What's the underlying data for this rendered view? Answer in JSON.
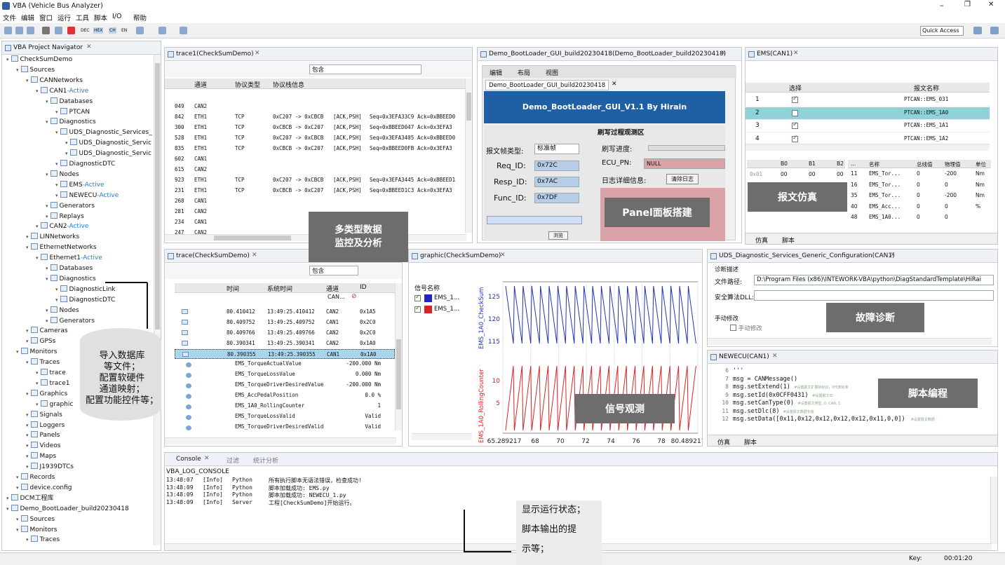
{
  "window": {
    "title": "VBA (Vehicle Bus Analyzer)",
    "minimize": "–",
    "restore": "❐",
    "close": "✕"
  },
  "menu": [
    "文件",
    "编辑",
    "窗口",
    "运行",
    "工具",
    "脚本",
    "I/O",
    "帮助"
  ],
  "toolbar": {
    "dec": "DEC",
    "hex": "HEX",
    "ch": "CH",
    "en": "EN",
    "quick_access": "Quick Access"
  },
  "navigator": {
    "title": "VBA Project Navigator",
    "tree": [
      {
        "l": 0,
        "t": "CheckSumDemo"
      },
      {
        "l": 1,
        "t": "Sources"
      },
      {
        "l": 2,
        "t": "CANNetworks"
      },
      {
        "l": 3,
        "t": "CAN1",
        "a": "-Active"
      },
      {
        "l": 4,
        "t": "Databases"
      },
      {
        "l": 5,
        "t": "PTCAN"
      },
      {
        "l": 4,
        "t": "Diagnostics"
      },
      {
        "l": 5,
        "t": "UDS_Diagnostic_Services_"
      },
      {
        "l": 6,
        "t": "UDS_Diagnostic_Servic"
      },
      {
        "l": 6,
        "t": "UDS_Diagnostic_Servic"
      },
      {
        "l": 5,
        "t": "DiagnosticDTC"
      },
      {
        "l": 4,
        "t": "Nodes"
      },
      {
        "l": 5,
        "t": "EMS",
        "a": "-Active"
      },
      {
        "l": 5,
        "t": "NEWECU",
        "a": "-Active"
      },
      {
        "l": 4,
        "t": "Generators"
      },
      {
        "l": 4,
        "t": "Replays"
      },
      {
        "l": 3,
        "t": "CAN2",
        "a": "-Active"
      },
      {
        "l": 2,
        "t": "LINNetworks"
      },
      {
        "l": 2,
        "t": "EthernetNetworks"
      },
      {
        "l": 3,
        "t": "Ethernet1",
        "a": "-Active"
      },
      {
        "l": 4,
        "t": "Databases"
      },
      {
        "l": 4,
        "t": "Diagnostics"
      },
      {
        "l": 5,
        "t": "DiagnosticLink"
      },
      {
        "l": 5,
        "t": "DiagnosticDTC"
      },
      {
        "l": 4,
        "t": "Nodes"
      },
      {
        "l": 4,
        "t": "Generators"
      },
      {
        "l": 2,
        "t": "Cameras"
      },
      {
        "l": 2,
        "t": "GPSs"
      },
      {
        "l": 1,
        "t": "Monitors"
      },
      {
        "l": 2,
        "t": "Traces"
      },
      {
        "l": 3,
        "t": "trace"
      },
      {
        "l": 3,
        "t": "trace1"
      },
      {
        "l": 2,
        "t": "Graphics"
      },
      {
        "l": 3,
        "t": "graphic"
      },
      {
        "l": 2,
        "t": "Signals"
      },
      {
        "l": 2,
        "t": "Loggers"
      },
      {
        "l": 2,
        "t": "Panels"
      },
      {
        "l": 2,
        "t": "Videos"
      },
      {
        "l": 2,
        "t": "Maps"
      },
      {
        "l": 2,
        "t": "J1939DTCs"
      },
      {
        "l": 1,
        "t": "Records"
      },
      {
        "l": 1,
        "t": "device.config"
      },
      {
        "l": 0,
        "t": "DCM工程库"
      },
      {
        "l": 0,
        "t": "Demo_BootLoader_build20230418"
      },
      {
        "l": 1,
        "t": "Sources"
      },
      {
        "l": 1,
        "t": "Monitors"
      },
      {
        "l": 2,
        "t": "Traces"
      }
    ]
  },
  "trace1": {
    "title": "trace1(CheckSumDemo)",
    "filter": "包含",
    "cols": [
      "通道",
      "协议类型",
      "协议栈信息"
    ],
    "rows": [
      [
        "049",
        "CAN2",
        "",
        "",
        "",
        ""
      ],
      [
        "842",
        "ETH1",
        "TCP",
        "0xC207 -> 0xCBCB",
        "[ACK,PSH]",
        "Seq=0x3EFA33C9",
        "Ack=0xBBEED0"
      ],
      [
        "300",
        "ETH1",
        "TCP",
        "0xCBCB -> 0xC207",
        "[ACK,PSH]",
        "Seq=0xBBEED047",
        "Ack=0x3EFA3"
      ],
      [
        "528",
        "ETH1",
        "TCP",
        "0xC207 -> 0xCBCB",
        "[ACK,PSH]",
        "Seq=0x3EFA3405",
        "Ack=0xBBEED0"
      ],
      [
        "835",
        "ETH1",
        "TCP",
        "0xCBCB -> 0xC207",
        "[ACK,PSH]",
        "Seq=0xBBEED0FB",
        "Ack=0x3EFA3"
      ],
      [
        "602",
        "CAN1",
        "",
        "",
        "",
        ""
      ],
      [
        "615",
        "CAN2",
        "",
        "",
        "",
        ""
      ],
      [
        "923",
        "ETH1",
        "TCP",
        "0xC207 -> 0xCBCB",
        "[ACK,PSH]",
        "Seq=0x3EFA3445",
        "Ack=0xBBEED1"
      ],
      [
        "231",
        "ETH1",
        "TCP",
        "0xCBCB -> 0xC207",
        "[ACK,PSH]",
        "Seq=0xBBEED1C3",
        "Ack=0x3EFA3"
      ],
      [
        "268",
        "CAN1",
        "",
        "",
        "",
        ""
      ],
      [
        "281",
        "CAN2",
        "",
        "",
        "",
        ""
      ],
      [
        "234",
        "CAN1",
        "",
        "",
        "",
        ""
      ],
      [
        "247",
        "CAN2",
        "",
        "",
        "",
        ""
      ]
    ]
  },
  "trace": {
    "title": "trace(CheckSumDemo)",
    "filter": "包含",
    "cols": [
      "时间",
      "系统时间",
      "通道",
      "ID"
    ],
    "chan_filter": "CAN...",
    "rows": [
      [
        "80.410412",
        "13:49:25.410412",
        "CAN2",
        "0x1A5"
      ],
      [
        "80.409752",
        "13:49:25.409752",
        "CAN1",
        "0x2C0"
      ],
      [
        "80.409766",
        "13:49:25.409766",
        "CAN2",
        "0x2C0"
      ],
      [
        "80.390341",
        "13:49:25.390341",
        "CAN2",
        "0x1A0"
      ],
      [
        "80.390355",
        "13:49:25.390355",
        "CAN1",
        "0x1A0"
      ]
    ],
    "signals": [
      [
        "EMS_TorqueActualValue",
        "-200.000 Nm"
      ],
      [
        "EMS_TorqueLossValue",
        "0.000 Nm"
      ],
      [
        "EMS_TorqueDriverDesiredValue",
        "-200.000 Nm"
      ],
      [
        "EMS_AccPedalPosition",
        "0.0 %"
      ],
      [
        "EMS_1A0_RollingCounter",
        "1"
      ],
      [
        "EMS_TorqueLossValid",
        "Valid"
      ],
      [
        "EMS_TorqueDriverDesiredValid",
        "Valid"
      ]
    ]
  },
  "panel": {
    "title": "Demo_BootLoader_GUI_build20230418(Demo_BootLoader_build20230418)",
    "menus": [
      "编辑",
      "布局",
      "视图"
    ],
    "tab": "Demo_BootLoader_GUI_build20230418",
    "banner": "Demo_BootLoader_GUI_V1.1    By Hirain",
    "section": "刷写过程观测区",
    "frame_type_label": "报文帧类型:",
    "frame_type": "标准帧",
    "req_label": "Req_ID:",
    "req": "0x72C",
    "resp_label": "Resp_ID:",
    "resp": "0x7AC",
    "func_label": "Func_ID:",
    "func": "0x7DF",
    "progress_label": "刷写进度:",
    "ecu_label": "ECU_PN:",
    "ecu": "NULL",
    "log_label": "日志详细信息:",
    "clear": "清除日志",
    "browse": "浏览"
  },
  "ems": {
    "title": "EMS(CAN1)",
    "cols": [
      "选择",
      "报文名称"
    ],
    "rows": [
      [
        "1",
        true,
        "PTCAN::EMS_031"
      ],
      [
        "2",
        false,
        "PTCAN::EMS_1A0"
      ],
      [
        "3",
        true,
        "PTCAN::EMS_1A1"
      ],
      [
        "4",
        true,
        "PTCAN::EMS_1A2"
      ]
    ],
    "bytes": {
      "cols": [
        "B0",
        "B1",
        "B2"
      ],
      "id": "0x01",
      "vals": [
        "00",
        "00",
        "00"
      ]
    },
    "sig_cols": [
      "...",
      "名称",
      "总线值",
      "物理值",
      "单位"
    ],
    "sigs": [
      [
        "11",
        "EMS_Tor...",
        "0",
        "-200",
        "Nm"
      ],
      [
        "16",
        "EMS_Tor...",
        "0",
        "0",
        "Nm"
      ],
      [
        "35",
        "EMS_Tor...",
        "0",
        "-200",
        "Nm"
      ],
      [
        "40",
        "EMS_Acc...",
        "0",
        "0",
        "%"
      ],
      [
        "48",
        "EMS_1A0...",
        "0",
        "0",
        ""
      ]
    ],
    "tabs": [
      "仿真",
      "脚本"
    ]
  },
  "graphic": {
    "title": "graphic(CheckSumDemo)",
    "sig_header": "信号名称",
    "sigs": [
      {
        "name": "EMS_1...",
        "color": "#2222cc"
      },
      {
        "name": "EMS_1...",
        "color": "#dd2222"
      }
    ],
    "y1_label": "EMS_1A0_CheckSum",
    "y2_label": "EMS_1A0_RollingCounter",
    "y1_ticks": [
      "125",
      "120",
      "115"
    ],
    "y2_ticks": [
      "10",
      "5"
    ],
    "x_ticks": [
      "65.289217",
      "68",
      "70",
      "72",
      "74",
      "76",
      "78",
      "80.489217"
    ]
  },
  "uds": {
    "title": "UDS_Diagnostic_Services_Generic_Configuration(CAN1)",
    "section": "诊断描述",
    "path_label": "文件路径:",
    "path": "D:\\Program Files (x86)\\INTEWORK-VBA\\python\\DiagStandardTemplate\\HiRai",
    "dll_label": "安全算法DLL:",
    "manual": "手动修改",
    "manual_cb": "手动修改"
  },
  "newecu": {
    "title": "NEWECU(CAN1)",
    "lines": [
      [
        "6",
        "'''"
      ],
      [
        "7",
        "msg = CANMessage()"
      ],
      [
        "8",
        "msg.setExtend(1)"
      ],
      [
        "9",
        "msg.setId(0x0CFF0431)"
      ],
      [
        "10",
        "msg.setCanType(0)"
      ],
      [
        "11",
        "msg.setDlc(8)"
      ],
      [
        "12",
        "msg.setData([0x11,0x12,0x12,0x12,0x12,0x11,0,0])"
      ]
    ],
    "comments": [
      "#设置报文扩展帧标识，0代表标准",
      "#设置报文ID",
      "#设置报文类型, 0: CAN, 1: ",
      "#设置报文数据长度",
      "#设置报文数据"
    ],
    "tabs": [
      "仿真",
      "脚本"
    ]
  },
  "console": {
    "tabs": [
      "Console",
      "过滤",
      "统计分析"
    ],
    "name": "VBA_LOG_CONSOLE",
    "lines": [
      [
        "13:48:07",
        "[Info]",
        "Python",
        "所有执行脚本无语法错误，检查成功!"
      ],
      [
        "13:48:09",
        "[Info]",
        "Python",
        "脚本加载成功: EMS.py"
      ],
      [
        "13:48:09",
        "[Info]",
        "Python",
        "脚本加载成功: NEWECU_1.py"
      ],
      [
        "13:48:09",
        "[Info]",
        "Server",
        "工程[CheckSumDemo]开始运行。"
      ]
    ]
  },
  "status": {
    "key": "Key:",
    "time": "00:01:20"
  },
  "callouts": {
    "import": "导入数据库\n等文件；\n配置软硬件\n通道映射；\n配置功能控件等；",
    "monitor": "多类型数据\n监控及分析",
    "panel": "Panel面板搭建",
    "sim": "报文仿真",
    "signal": "信号观测",
    "diag": "故障诊断",
    "script": "脚本编程",
    "console": "显示运行状态；\n脚本输出的提\n示等；"
  }
}
